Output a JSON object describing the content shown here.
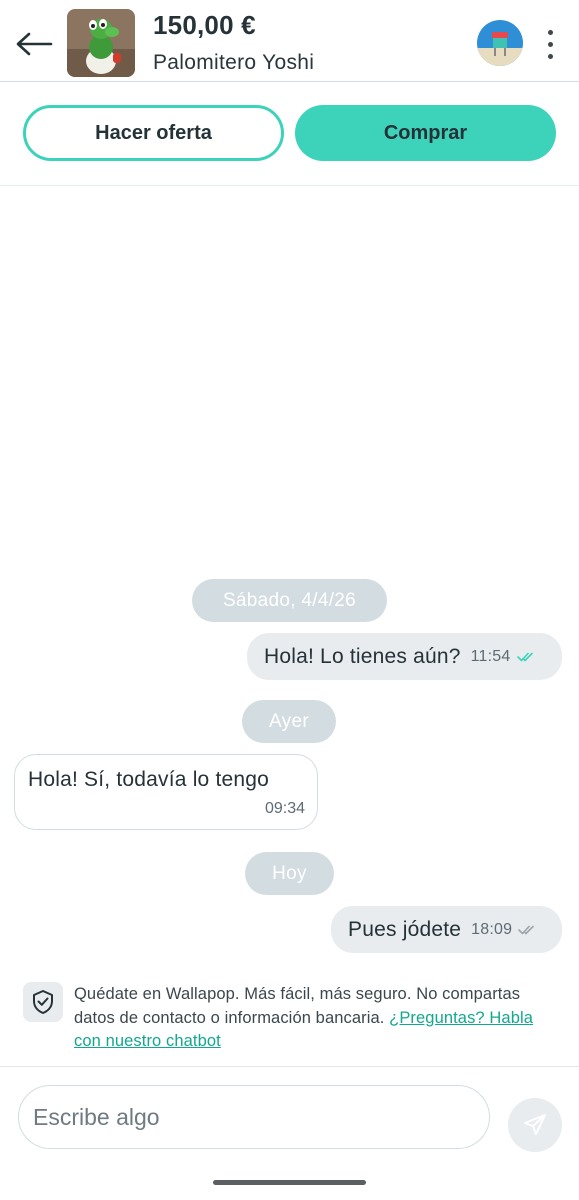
{
  "header": {
    "back_icon": "arrow-left-icon",
    "price": "150,00 €",
    "item_title": "Palomitero Yoshi",
    "more_icon": "more-vertical-icon"
  },
  "actions": {
    "offer_label": "Hacer oferta",
    "buy_label": "Comprar",
    "accent_color": "#3dd2ba"
  },
  "chat": {
    "separators": [
      "Sábado, 4/4/26",
      "Ayer",
      "Hoy"
    ],
    "messages": [
      {
        "direction": "outgoing",
        "text": "Hola! Lo tienes aún?",
        "time": "11:54",
        "status": "read"
      },
      {
        "direction": "incoming",
        "text": "Hola! Sí, todavía lo tengo",
        "time": "09:34"
      },
      {
        "direction": "outgoing",
        "text": "Pues jódete",
        "time": "18:09",
        "status": "delivered"
      }
    ]
  },
  "notice": {
    "icon": "shield-check-icon",
    "text": "Quédate en Wallapop. Más fácil, más seguro. No compartas datos de contacto o información bancaria. ",
    "link": "¿Preguntas? Habla con nuestro chatbot"
  },
  "composer": {
    "placeholder": "Escribe algo",
    "send_icon": "send-icon"
  }
}
